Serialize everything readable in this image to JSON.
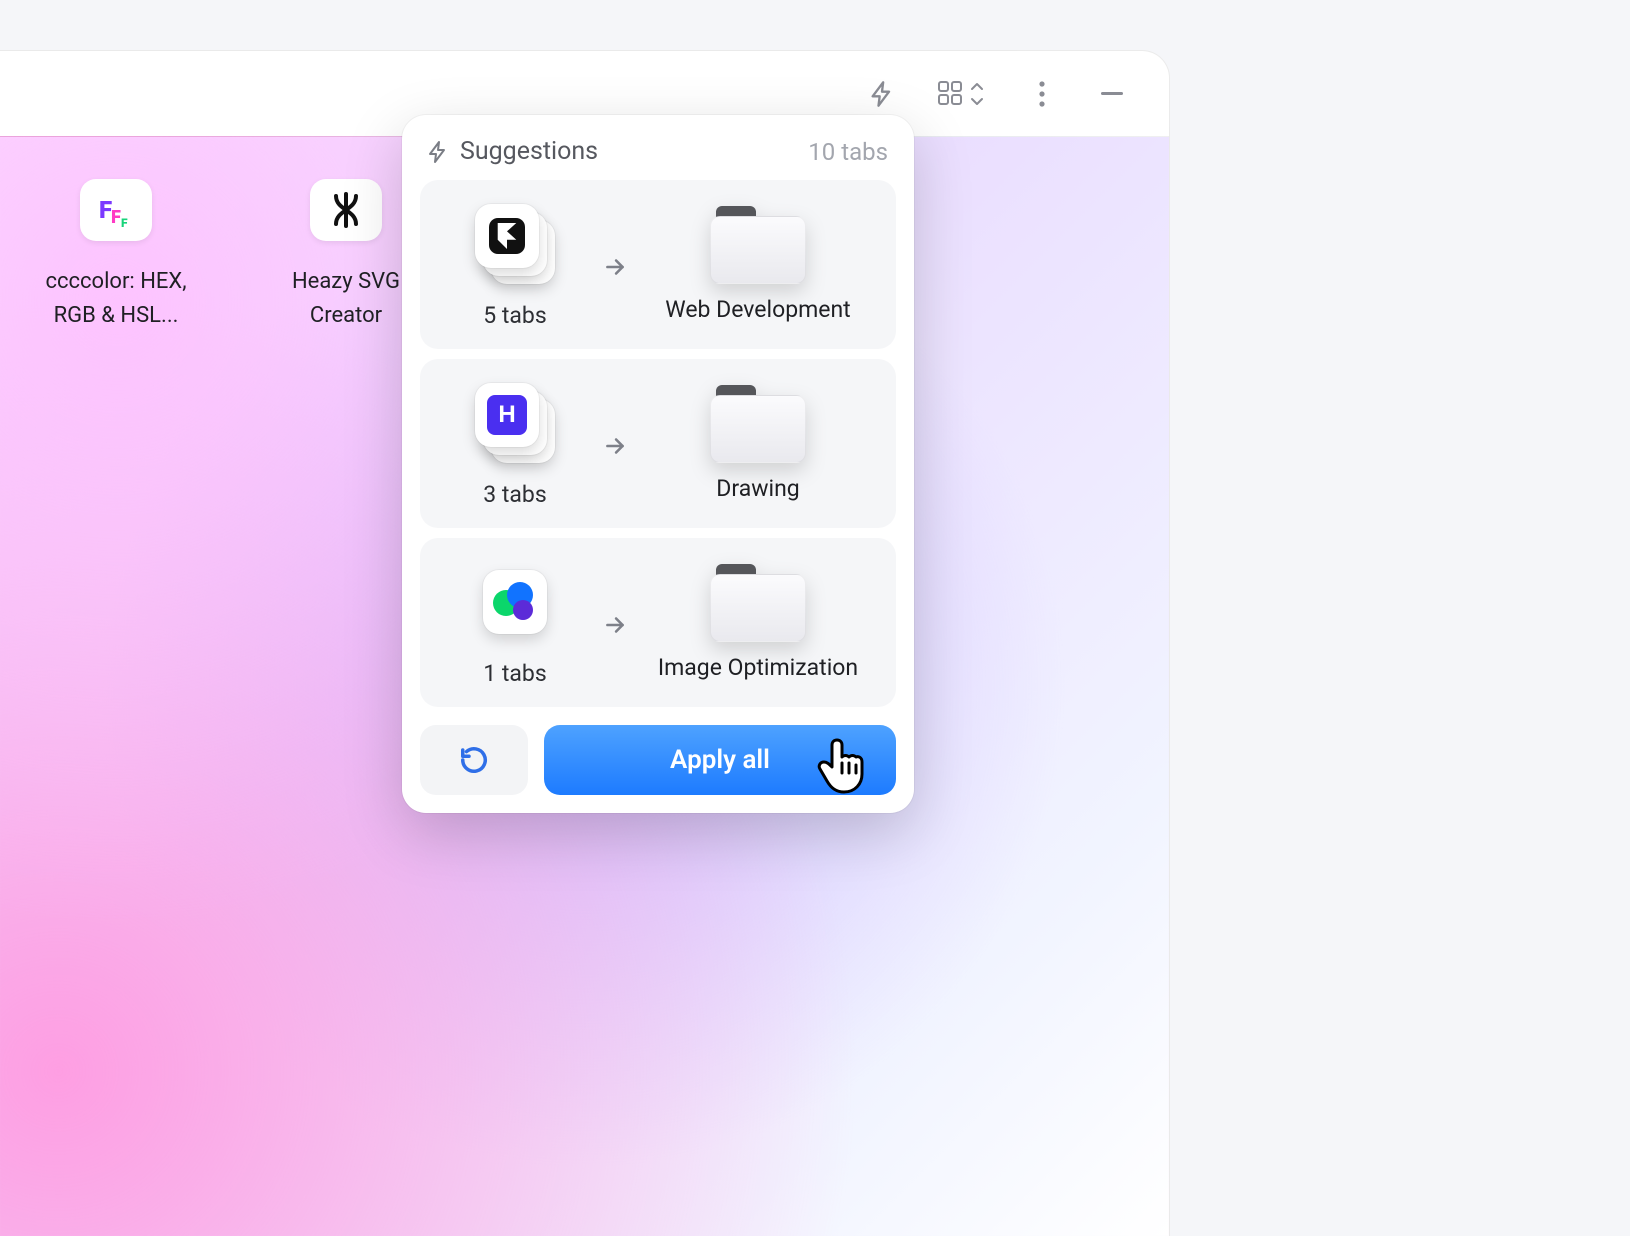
{
  "toolbar": {
    "bolt_icon": "bolt-icon",
    "grid_icon": "grid-switch-icon",
    "more_icon": "more-vertical-icon",
    "minimize_icon": "minimize-icon"
  },
  "desktop": {
    "items": [
      {
        "label": "ccccolor: HEX, RGB & HSL...",
        "icon": "ff-icon"
      },
      {
        "label": "Heazy SVG Creator",
        "icon": "swirl-icon"
      }
    ]
  },
  "suggestions": {
    "title": "Suggestions",
    "total_label": "10 tabs",
    "items": [
      {
        "tabs_label": "5 tabs",
        "folder_name": "Web Development",
        "icon": "framer-icon",
        "stack": "multi"
      },
      {
        "tabs_label": "3 tabs",
        "folder_name": "Drawing",
        "icon": "h-icon",
        "stack": "multi"
      },
      {
        "tabs_label": "1 tabs",
        "folder_name": "Image Optimization",
        "icon": "blobs-icon",
        "stack": "single"
      }
    ],
    "refresh_label": "",
    "apply_label": "Apply all"
  }
}
